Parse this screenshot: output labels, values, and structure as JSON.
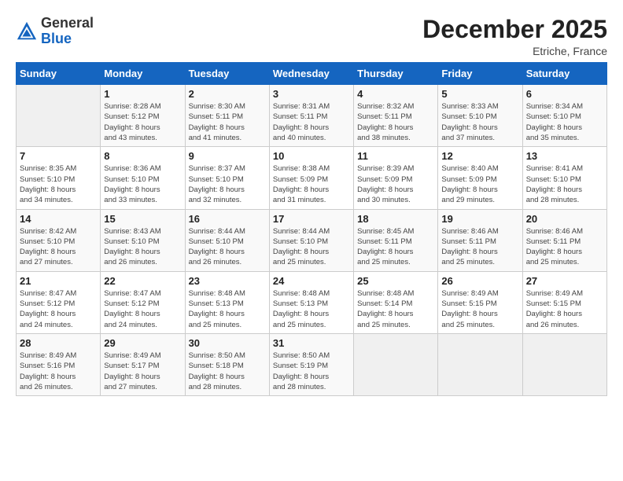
{
  "header": {
    "logo_general": "General",
    "logo_blue": "Blue",
    "month": "December 2025",
    "location": "Etriche, France"
  },
  "weekdays": [
    "Sunday",
    "Monday",
    "Tuesday",
    "Wednesday",
    "Thursday",
    "Friday",
    "Saturday"
  ],
  "weeks": [
    [
      {
        "day": "",
        "info": ""
      },
      {
        "day": "1",
        "info": "Sunrise: 8:28 AM\nSunset: 5:12 PM\nDaylight: 8 hours\nand 43 minutes."
      },
      {
        "day": "2",
        "info": "Sunrise: 8:30 AM\nSunset: 5:11 PM\nDaylight: 8 hours\nand 41 minutes."
      },
      {
        "day": "3",
        "info": "Sunrise: 8:31 AM\nSunset: 5:11 PM\nDaylight: 8 hours\nand 40 minutes."
      },
      {
        "day": "4",
        "info": "Sunrise: 8:32 AM\nSunset: 5:11 PM\nDaylight: 8 hours\nand 38 minutes."
      },
      {
        "day": "5",
        "info": "Sunrise: 8:33 AM\nSunset: 5:10 PM\nDaylight: 8 hours\nand 37 minutes."
      },
      {
        "day": "6",
        "info": "Sunrise: 8:34 AM\nSunset: 5:10 PM\nDaylight: 8 hours\nand 35 minutes."
      }
    ],
    [
      {
        "day": "7",
        "info": "Sunrise: 8:35 AM\nSunset: 5:10 PM\nDaylight: 8 hours\nand 34 minutes."
      },
      {
        "day": "8",
        "info": "Sunrise: 8:36 AM\nSunset: 5:10 PM\nDaylight: 8 hours\nand 33 minutes."
      },
      {
        "day": "9",
        "info": "Sunrise: 8:37 AM\nSunset: 5:10 PM\nDaylight: 8 hours\nand 32 minutes."
      },
      {
        "day": "10",
        "info": "Sunrise: 8:38 AM\nSunset: 5:09 PM\nDaylight: 8 hours\nand 31 minutes."
      },
      {
        "day": "11",
        "info": "Sunrise: 8:39 AM\nSunset: 5:09 PM\nDaylight: 8 hours\nand 30 minutes."
      },
      {
        "day": "12",
        "info": "Sunrise: 8:40 AM\nSunset: 5:09 PM\nDaylight: 8 hours\nand 29 minutes."
      },
      {
        "day": "13",
        "info": "Sunrise: 8:41 AM\nSunset: 5:10 PM\nDaylight: 8 hours\nand 28 minutes."
      }
    ],
    [
      {
        "day": "14",
        "info": "Sunrise: 8:42 AM\nSunset: 5:10 PM\nDaylight: 8 hours\nand 27 minutes."
      },
      {
        "day": "15",
        "info": "Sunrise: 8:43 AM\nSunset: 5:10 PM\nDaylight: 8 hours\nand 26 minutes."
      },
      {
        "day": "16",
        "info": "Sunrise: 8:44 AM\nSunset: 5:10 PM\nDaylight: 8 hours\nand 26 minutes."
      },
      {
        "day": "17",
        "info": "Sunrise: 8:44 AM\nSunset: 5:10 PM\nDaylight: 8 hours\nand 25 minutes."
      },
      {
        "day": "18",
        "info": "Sunrise: 8:45 AM\nSunset: 5:11 PM\nDaylight: 8 hours\nand 25 minutes."
      },
      {
        "day": "19",
        "info": "Sunrise: 8:46 AM\nSunset: 5:11 PM\nDaylight: 8 hours\nand 25 minutes."
      },
      {
        "day": "20",
        "info": "Sunrise: 8:46 AM\nSunset: 5:11 PM\nDaylight: 8 hours\nand 25 minutes."
      }
    ],
    [
      {
        "day": "21",
        "info": "Sunrise: 8:47 AM\nSunset: 5:12 PM\nDaylight: 8 hours\nand 24 minutes."
      },
      {
        "day": "22",
        "info": "Sunrise: 8:47 AM\nSunset: 5:12 PM\nDaylight: 8 hours\nand 24 minutes."
      },
      {
        "day": "23",
        "info": "Sunrise: 8:48 AM\nSunset: 5:13 PM\nDaylight: 8 hours\nand 25 minutes."
      },
      {
        "day": "24",
        "info": "Sunrise: 8:48 AM\nSunset: 5:13 PM\nDaylight: 8 hours\nand 25 minutes."
      },
      {
        "day": "25",
        "info": "Sunrise: 8:48 AM\nSunset: 5:14 PM\nDaylight: 8 hours\nand 25 minutes."
      },
      {
        "day": "26",
        "info": "Sunrise: 8:49 AM\nSunset: 5:15 PM\nDaylight: 8 hours\nand 25 minutes."
      },
      {
        "day": "27",
        "info": "Sunrise: 8:49 AM\nSunset: 5:15 PM\nDaylight: 8 hours\nand 26 minutes."
      }
    ],
    [
      {
        "day": "28",
        "info": "Sunrise: 8:49 AM\nSunset: 5:16 PM\nDaylight: 8 hours\nand 26 minutes."
      },
      {
        "day": "29",
        "info": "Sunrise: 8:49 AM\nSunset: 5:17 PM\nDaylight: 8 hours\nand 27 minutes."
      },
      {
        "day": "30",
        "info": "Sunrise: 8:50 AM\nSunset: 5:18 PM\nDaylight: 8 hours\nand 28 minutes."
      },
      {
        "day": "31",
        "info": "Sunrise: 8:50 AM\nSunset: 5:19 PM\nDaylight: 8 hours\nand 28 minutes."
      },
      {
        "day": "",
        "info": ""
      },
      {
        "day": "",
        "info": ""
      },
      {
        "day": "",
        "info": ""
      }
    ]
  ]
}
